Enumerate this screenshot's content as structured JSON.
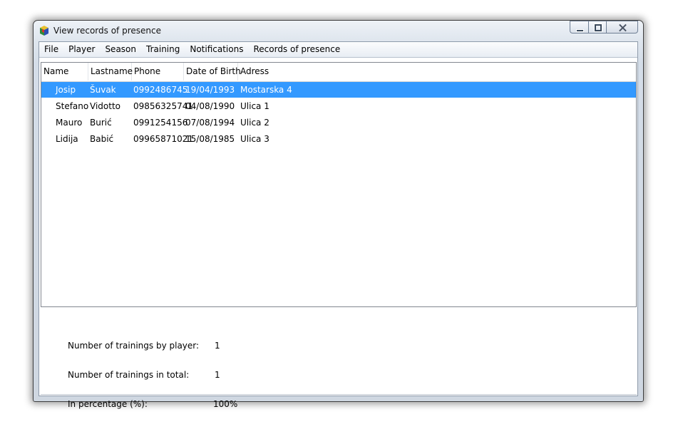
{
  "window": {
    "title": "View records of presence"
  },
  "menu": [
    "File",
    "Player",
    "Season",
    "Training",
    "Notifications",
    "Records of presence"
  ],
  "table": {
    "columns": [
      "Name",
      "Lastname",
      "Phone",
      "Date of Birth",
      "Adress"
    ],
    "rows": [
      [
        "Josip",
        "Šuvak",
        "0992486745",
        "19/04/1993",
        "Mostarska 4"
      ],
      [
        "Stefano",
        "Vidotto",
        "09856325741",
        "04/08/1990",
        "Ulica 1"
      ],
      [
        "Mauro",
        "Burić",
        "0991254156",
        "07/08/1994",
        "Ulica 2"
      ],
      [
        "Lidija",
        "Babić",
        "09965871021",
        "15/08/1985",
        "Ulica 3"
      ]
    ],
    "selected_row": 0
  },
  "stats": {
    "by_player_label": "Number of trainings by player:",
    "by_player_value": "1",
    "total_label": "Number of trainings in total:",
    "total_value": "1",
    "percentage_label": "In percentage (%):",
    "percentage_value": "100%"
  },
  "colors": {
    "selection": "#3399ff",
    "selection_text": "#ffffff"
  },
  "icons": {
    "app": "app-cube-icon"
  }
}
